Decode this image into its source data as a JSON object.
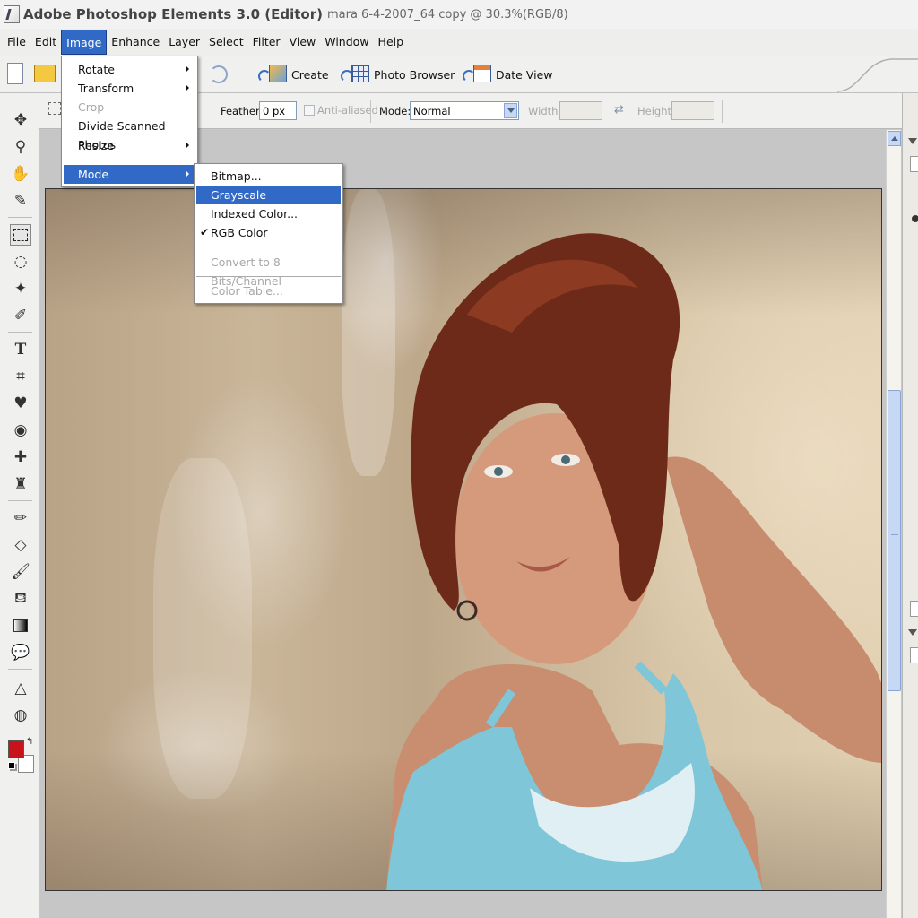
{
  "titlebar": {
    "app_title": "Adobe Photoshop Elements 3.0 (Editor)",
    "document_title": "mara 6-4-2007_64 copy @ 30.3%(RGB/8)",
    "app_icon": "photoshop-elements-icon"
  },
  "menubar": {
    "items": [
      "File",
      "Edit",
      "Image",
      "Enhance",
      "Layer",
      "Select",
      "Filter",
      "View",
      "Window",
      "Help"
    ],
    "active": "Image"
  },
  "shortcuts": {
    "create_label": "Create",
    "photo_browser_label": "Photo Browser",
    "date_view_label": "Date View",
    "icons": [
      "new-document-icon",
      "open-folder-icon",
      "redo-icon",
      "create-icon",
      "photo-browser-icon",
      "date-view-icon"
    ]
  },
  "options": {
    "feather_label": "Feather:",
    "feather_value": "0 px",
    "anti_aliased_label": "Anti-aliased",
    "mode_label": "Mode:",
    "mode_value": "Normal",
    "width_label": "Width:",
    "height_label": "Height:"
  },
  "toolbox": {
    "tools": [
      "move-tool",
      "zoom-tool",
      "hand-tool",
      "eyedropper-tool",
      "rectangular-marquee-tool",
      "lasso-tool",
      "magic-wand-tool",
      "selection-brush-tool",
      "type-tool",
      "crop-tool",
      "cookie-cutter-tool",
      "red-eye-removal-tool",
      "healing-brush-tool",
      "clone-stamp-tool",
      "pencil-tool",
      "eraser-tool",
      "brush-tool",
      "paint-bucket-tool",
      "gradient-tool",
      "shape-tool",
      "blur-tool",
      "sponge-tool"
    ],
    "selected_tool": "rectangular-marquee-tool",
    "foreground_color": "#c9131a",
    "background_color": "#ffffff"
  },
  "image_menu": {
    "items": [
      {
        "label": "Rotate",
        "submenu": true,
        "disabled": false
      },
      {
        "label": "Transform",
        "submenu": true,
        "disabled": false
      },
      {
        "label": "Crop",
        "submenu": false,
        "disabled": true
      },
      {
        "label": "Divide Scanned Photos",
        "submenu": false,
        "disabled": false
      },
      {
        "label": "Resize",
        "submenu": true,
        "disabled": false
      },
      {
        "label": "Mode",
        "submenu": true,
        "disabled": false,
        "highlighted": true
      }
    ]
  },
  "mode_menu": {
    "items": [
      {
        "label": "Bitmap...",
        "disabled": false
      },
      {
        "label": "Grayscale",
        "disabled": false,
        "highlighted": true
      },
      {
        "label": "Indexed Color...",
        "disabled": false
      },
      {
        "label": "RGB Color",
        "disabled": false,
        "checked": true
      },
      {
        "label": "Convert to 8 Bits/Channel",
        "disabled": true
      },
      {
        "label": "Color Table...",
        "disabled": true
      }
    ],
    "check_mark": "✔"
  },
  "accent_color": "#3169c6"
}
